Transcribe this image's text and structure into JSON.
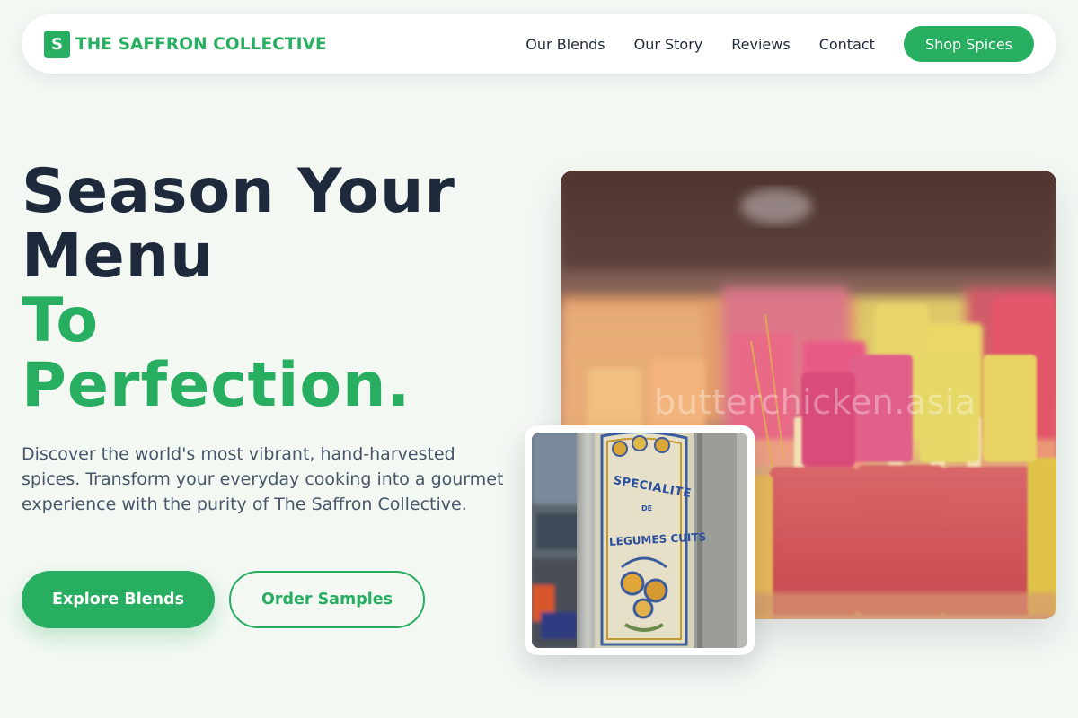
{
  "brand": {
    "mark": "S",
    "name": "THE SAFFRON COLLECTIVE"
  },
  "nav": {
    "links": [
      "Our Blends",
      "Our Story",
      "Reviews",
      "Contact"
    ],
    "cta": "Shop Spices"
  },
  "hero": {
    "title_dark": [
      "Season Your",
      "Menu"
    ],
    "title_accent": [
      "To",
      "Perfection."
    ],
    "description": "Discover the world's most vibrant, hand-harvested spices. Transform your everyday cooking into a gourmet experience with the purity of The Saffron Collective.",
    "primary_button": "Explore Blends",
    "secondary_button": "Order Samples"
  },
  "images": {
    "main_watermark": "butterchicken.asia",
    "inset_sign": {
      "line1": "SPECIALITE",
      "line2": "DE",
      "line3": "LEGUMES CUITS"
    }
  },
  "colors": {
    "accent": "#27ae60",
    "heading": "#1e293b",
    "body_text": "#475569",
    "background": "#f3f8f3"
  }
}
